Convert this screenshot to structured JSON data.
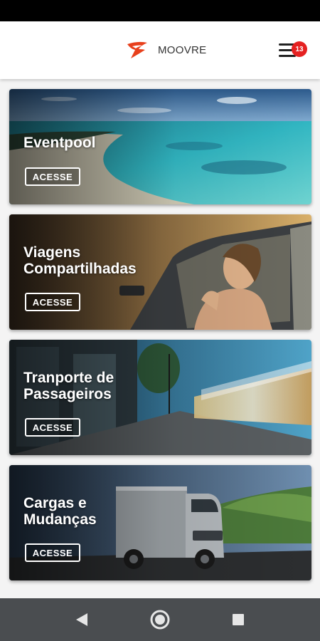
{
  "header": {
    "app_name": "MOOVRE",
    "notification_count": "13",
    "brand_color": "#e8401c",
    "menu_icon": "hamburger-menu-icon"
  },
  "cards": [
    {
      "title": "Eventpool",
      "button_label": "ACESSE",
      "image": "tropical-beach-lagoon"
    },
    {
      "title": "Viagens\nCompartilhadas",
      "button_label": "ACESSE",
      "image": "woman-in-car-window"
    },
    {
      "title": "Tranporte de\nPassageiros",
      "button_label": "ACESSE",
      "image": "bus-motion-street"
    },
    {
      "title": "Cargas e\nMudanças",
      "button_label": "ACESSE",
      "image": "delivery-truck-road"
    }
  ],
  "nav": {
    "back_icon": "back-triangle-icon",
    "home_icon": "home-circle-icon",
    "recents_icon": "recents-square-icon"
  }
}
